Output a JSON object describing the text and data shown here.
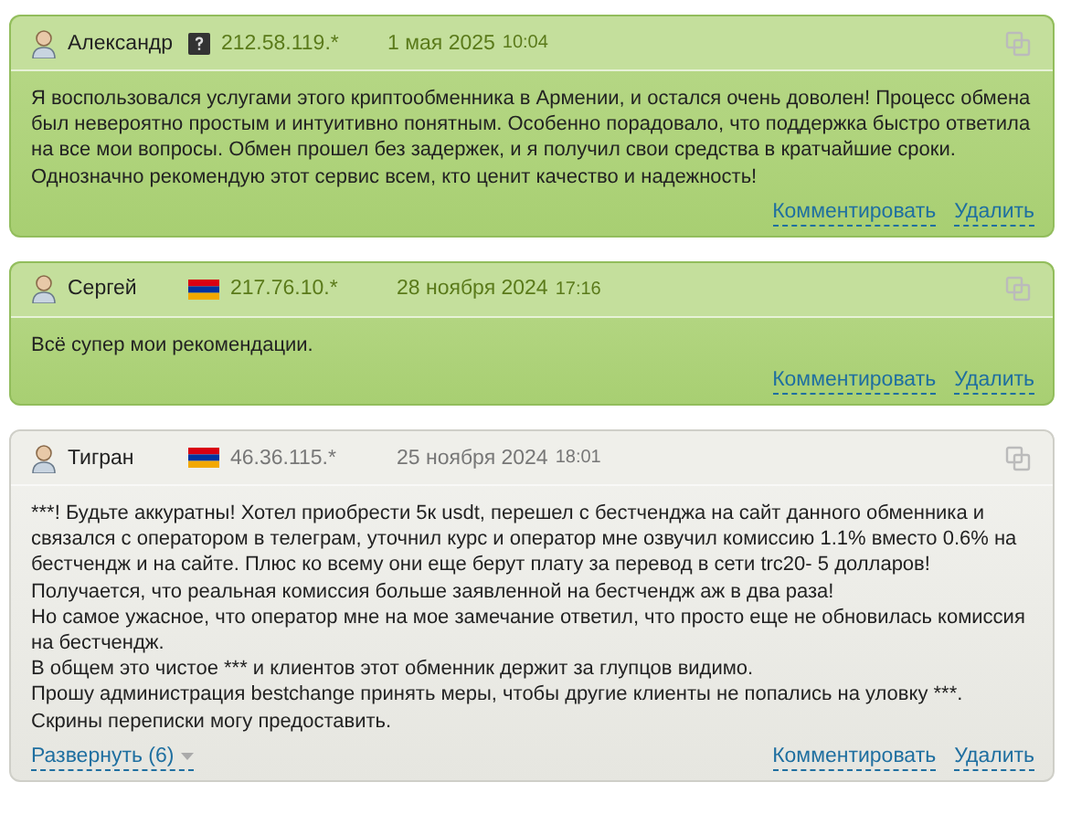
{
  "reviews": [
    {
      "kind": "positive",
      "author": "Александр",
      "flag": {
        "kind": "unknown"
      },
      "ip": "212.58.119.*",
      "date": "1 мая 2025",
      "time": "10:04",
      "paragraphs": [
        "Я воспользовался услугами этого криптообменника в Армении, и остался очень доволен! Процесс обмена был невероятно простым и интуитивно понятным. Особенно порадовало, что поддержка быстро ответила на все мои вопросы. Обмен прошел без задержек, и я получил свои средства в кратчайшие сроки. Однозначно рекомендую этот сервис всем, кто ценит качество и надежность!"
      ],
      "actions": [
        "Комментировать",
        "Удалить"
      ]
    },
    {
      "kind": "positive",
      "author": "Сергей",
      "flag": {
        "kind": "armenia"
      },
      "ip": "217.76.10.*",
      "date": "28 ноября 2024",
      "time": "17:16",
      "paragraphs": [
        "Всё супер мои рекомендации."
      ],
      "actions": [
        "Комментировать",
        "Удалить"
      ]
    },
    {
      "kind": "neutral",
      "author": "Тигран",
      "flag": {
        "kind": "armenia"
      },
      "ip": "46.36.115.*",
      "date": "25 ноября 2024",
      "time": "18:01",
      "paragraphs": [
        "***! Будьте аккуратны! Хотел приобрести 5к usdt, перешел с бестченджа на сайт данного обменника и связался с оператором в телеграм, уточнил курс и оператор мне озвучил комиссию 1.1% вместо 0.6% на бестчендж и на сайте. Плюс ко всему они еще берут плату за перевод в сети trc20- 5 долларов! Получается, что реальная комиссия больше заявленной на бестчендж аж в два раза!",
        "Но самое ужасное, что оператор мне на мое замечание ответил, что просто еще не обновилась комиссия на бестчендж.",
        "В общем это чистое *** и клиентов этот обменник держит за глупцов видимо.",
        "Прошу администрация bestchange принять меры, чтобы другие клиенты не попались на уловку ***. Скрины переписки могу предоставить."
      ],
      "expand": "Развернуть (6)",
      "actions": [
        "Комментировать",
        "Удалить"
      ]
    }
  ]
}
